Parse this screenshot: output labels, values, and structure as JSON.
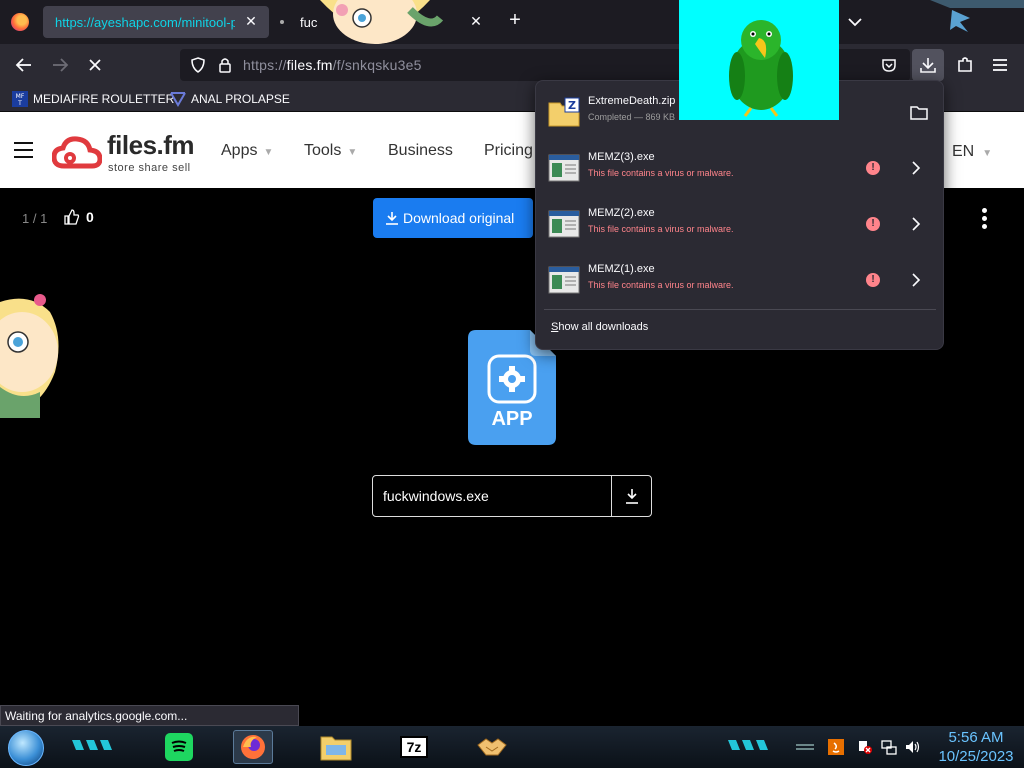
{
  "browser": {
    "tabs": [
      {
        "title": "https://ayeshapc.com/minitool-pa",
        "active": true
      },
      {
        "title": "fuc",
        "active": false
      }
    ],
    "url": {
      "prefix": "https://",
      "host": "files.fm",
      "path": "/f/snkqsku3e5"
    },
    "bookmarks": [
      {
        "label": "MEDIAFIRE ROULETTER",
        "icon_text": "MF T"
      },
      {
        "label": "ANAL PROLAPSE"
      }
    ],
    "status_text": "Waiting for analytics.google.com..."
  },
  "site": {
    "brand": {
      "name": "files.fm",
      "tagline": "store  share  sell"
    },
    "menu": [
      "Apps",
      "Tools",
      "Business",
      "Pricing"
    ],
    "language": "EN",
    "counter": "1 / 1",
    "likes": "0",
    "download_button": "Download original",
    "file_type_label": "APP",
    "file_name": "fuckwindows.exe"
  },
  "downloads_panel": {
    "items": [
      {
        "name": "ExtremeDeath.zip",
        "status": "Completed — 869 KB",
        "type": "zip",
        "warning": false
      },
      {
        "name": "MEMZ(3).exe",
        "status": "This file contains a virus or malware.",
        "type": "exe",
        "warning": true
      },
      {
        "name": "MEMZ(2).exe",
        "status": "This file contains a virus or malware.",
        "type": "exe",
        "warning": true
      },
      {
        "name": "MEMZ(1).exe",
        "status": "This file contains a virus or malware.",
        "type": "exe",
        "warning": true
      }
    ],
    "show_all": "Show all downloads"
  },
  "taskbar": {
    "clock_time": "5:56 AM",
    "clock_date": "10/25/2023",
    "apps": [
      "spotify-icon",
      "firefox-icon",
      "file-explorer-icon",
      "7zip-icon",
      "handshake-icon"
    ],
    "seven_zip_label": "7z"
  },
  "colors": {
    "accent_cyan": "#0fd3e6",
    "download_blue": "#1a7cf0",
    "virus_red": "#ff848b",
    "panel_bg": "#2b2a33",
    "parrot_bg": "#00ffff"
  }
}
